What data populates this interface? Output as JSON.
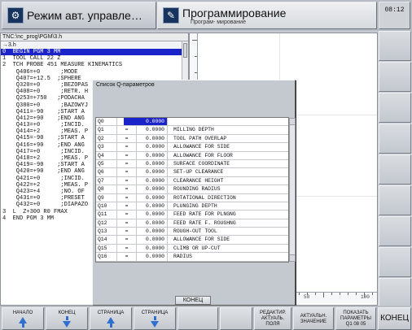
{
  "header": {
    "machine_mode": "Режим авт. управле…",
    "programming_mode": "Программирование",
    "programming_sub": "Програм- мирование",
    "clock": "08:12"
  },
  "editor": {
    "path": "TNC:\\nc_prog\\PGM\\3.h",
    "filename": "→3.h",
    "lines": [
      "0  BEGIN PGM 3 MM",
      "1  TOOL CALL 22 Z",
      "2  TCH PROBE 451 MEASURE KINEMATICS",
      "    Q406=+0      ;MODE",
      "    Q407=+12.5  ;SPHERE",
      "    Q320=+0      ;BEZOPAS",
      "    Q408=+0      ;RETR. H",
      "    Q253=+750   ;PODACHA",
      "    Q380=+0      ;BAZOWYJ",
      "    Q411=-90    ;START A",
      "    Q412=+90    ;END ANG",
      "    Q413=+0      ;INCID.",
      "    Q414=+2      ;MEAS. P",
      "    Q415=-90    ;START A",
      "    Q416=+90    ;END ANG",
      "    Q417=+0      ;INCID.",
      "    Q418=+2      ;MEAS. P",
      "    Q419=-90    ;START A",
      "    Q420=+90    ;END ANG",
      "    Q421=+0      ;INCID.",
      "    Q422=+2      ;MEAS. P",
      "    Q423=+4      ;NO. OF",
      "    Q431=+0      ;PRESET",
      "    Q432=+0      ;DIAPAZO",
      "3  L  Z+300 R0 FMAX",
      "4  END PGM 3 MM"
    ],
    "selected_line": 0
  },
  "graphic": {
    "h_ticks": [
      "0",
      "50",
      "100"
    ]
  },
  "dialog": {
    "title": "Список Q-параметров",
    "ok_label": "КОНЕЦ",
    "rows": [
      {
        "name": "Q0",
        "eq": "=",
        "value": "0.0000",
        "comment": ""
      },
      {
        "name": "Q1",
        "eq": "=",
        "value": "0.0000",
        "comment": "MILLING DEPTH"
      },
      {
        "name": "Q2",
        "eq": "=",
        "value": "0.0000",
        "comment": "TOOL PATH OVERLAP"
      },
      {
        "name": "Q3",
        "eq": "=",
        "value": "0.0000",
        "comment": "ALLOWANCE FOR SIDE"
      },
      {
        "name": "Q4",
        "eq": "=",
        "value": "0.0000",
        "comment": "ALLOWANCE FOR FLOOR"
      },
      {
        "name": "Q5",
        "eq": "=",
        "value": "0.0000",
        "comment": "SURFACE COORDINATE"
      },
      {
        "name": "Q6",
        "eq": "=",
        "value": "0.0000",
        "comment": "SET-UP CLEARANCE"
      },
      {
        "name": "Q7",
        "eq": "=",
        "value": "0.0000",
        "comment": "CLEARANCE HEIGHT"
      },
      {
        "name": "Q8",
        "eq": "=",
        "value": "0.0000",
        "comment": "ROUNDING RADIUS"
      },
      {
        "name": "Q9",
        "eq": "=",
        "value": "0.0000",
        "comment": "ROTATIONAL DIRECTION"
      },
      {
        "name": "Q10",
        "eq": "=",
        "value": "0.0000",
        "comment": "PLUNGING DEPTH"
      },
      {
        "name": "Q11",
        "eq": "=",
        "value": "0.0000",
        "comment": "FEED RATE FOR PLNGNG"
      },
      {
        "name": "Q12",
        "eq": "=",
        "value": "0.0000",
        "comment": "FEED RATE F. ROUGHNG"
      },
      {
        "name": "Q13",
        "eq": "=",
        "value": "0.0000",
        "comment": "ROUGH-OUT TOOL"
      },
      {
        "name": "Q14",
        "eq": "=",
        "value": "0.0000",
        "comment": "ALLOWANCE FOR SIDE"
      },
      {
        "name": "Q15",
        "eq": "=",
        "value": "0.0000",
        "comment": "CLIMB OR UP-CUT"
      },
      {
        "name": "Q16",
        "eq": "=",
        "value": "0.0000",
        "comment": "RADIUS"
      }
    ],
    "selected_row": 0
  },
  "softkeys": {
    "begin": "НАЧАЛО",
    "end": "КОНЕЦ",
    "page_up": "СТРАНИЦА",
    "page_down": "СТРАНИЦА",
    "edit_current": "РЕДАКТИР. АКТУАЛЬ. ПОЛЯ",
    "current_value": "АКТУАЛЬН. ЗНАЧЕНИЕ",
    "show_params": "ПОКАЗАТЬ ПАРАМЕТРЫ",
    "show_params_option": "Q1 08 05",
    "end_big": "КОНЕЦ"
  },
  "colors": {
    "selection": "#1b24c8",
    "arrow": "#2f6fd0",
    "panel_bg": "#c4c9cf"
  }
}
